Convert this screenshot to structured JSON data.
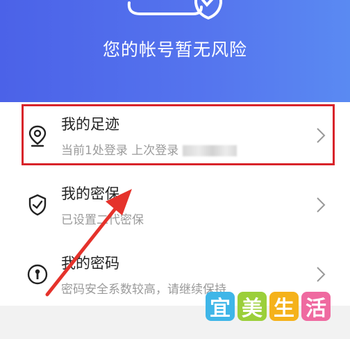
{
  "header": {
    "status_text": "您的帐号暂无风险",
    "gradient_start": "#4b62e8",
    "gradient_end": "#5a8af2"
  },
  "menu": [
    {
      "title": "我的足迹",
      "subtitle": "当前1处登录 上次登录",
      "icon": "location-pin-icon"
    },
    {
      "title": "我的密保",
      "subtitle": "已设置二代密保",
      "icon": "shield-check-icon"
    },
    {
      "title": "我的密码",
      "subtitle": "密码安全系数较高，请继续保持",
      "icon": "key-circle-icon"
    }
  ],
  "annotation": {
    "highlight_color": "#d8232a",
    "arrow_color": "#e5322b"
  },
  "watermark": {
    "chars": [
      "宜",
      "美",
      "生",
      "活"
    ],
    "colors": [
      "#3fb6e8",
      "#9bcf3a",
      "#f5b21b",
      "#ef6aa0"
    ]
  }
}
